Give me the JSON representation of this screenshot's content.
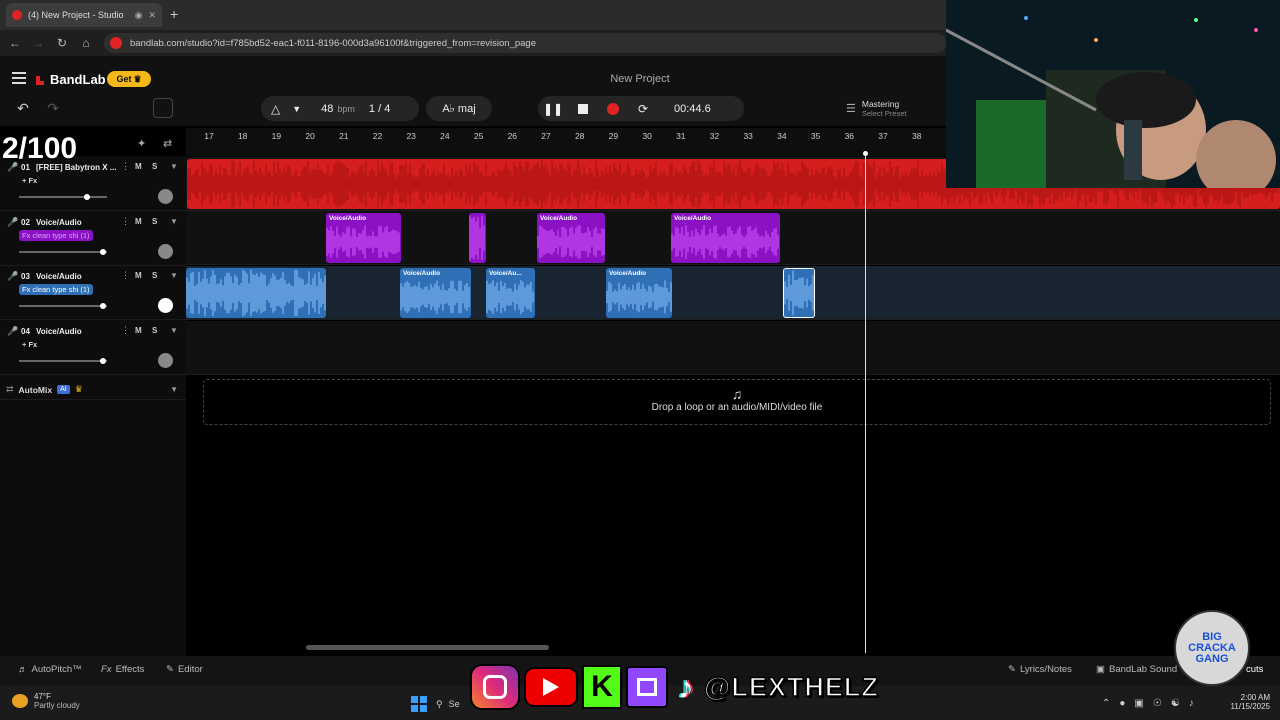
{
  "browser": {
    "tab_title": "(4) New Project - Studio",
    "url": "bandlab.com/studio?id=f785bd52-eac1-f011-8196-000d3a96100f&triggered_from=revision_page",
    "new_tab_symbol": "+"
  },
  "app": {
    "brand": "BandLab",
    "get_label": "Get",
    "project_title": "New Project"
  },
  "transport": {
    "bpm_value": "48",
    "bpm_unit": "bpm",
    "time_signature": "1 / 4",
    "key": "A♭ maj",
    "time": "00:44.6"
  },
  "mastering": {
    "title": "Mastering",
    "subtitle": "Select Preset"
  },
  "ruler": {
    "bars": [
      "17",
      "18",
      "19",
      "20",
      "21",
      "22",
      "23",
      "24",
      "25",
      "26",
      "27",
      "28",
      "29",
      "30",
      "31",
      "32",
      "33",
      "34",
      "35",
      "36",
      "37",
      "38"
    ]
  },
  "tracks": [
    {
      "number": "01",
      "name": "[FREE] Babytron X ...",
      "fx": "+ Fx",
      "color": "#e02424"
    },
    {
      "number": "02",
      "name": "Voice/Audio",
      "fx": "Fx clean type shi (1)",
      "color": "#9b1fd1"
    },
    {
      "number": "03",
      "name": "Voice/Audio",
      "fx": "Fx clean type shi (1)",
      "color": "#3e8fd8"
    },
    {
      "number": "04",
      "name": "Voice/Audio",
      "fx": "+ Fx",
      "color": "#2fbf71"
    }
  ],
  "clips": {
    "track2": [
      "Voice/Audio",
      "Voice/Audio",
      "Voice/Audio"
    ],
    "track3": [
      "Voice/Audio",
      "Voice/Au...",
      "Voice/Audio"
    ]
  },
  "mute_label": "M",
  "solo_label": "S",
  "automix": {
    "label": "AutoMix",
    "ai_badge": "AI"
  },
  "dropzone": {
    "text": "Drop a loop or an audio/MIDI/video file"
  },
  "bottom": {
    "autopitch": "AutoPitch™",
    "effects": "Effects",
    "editor": "Editor",
    "lyrics": "Lyrics/Notes",
    "sounds": "BandLab Sound",
    "shortcuts_partial": "cuts"
  },
  "taskbar": {
    "temp": "47°F",
    "weather": "Partly cloudy",
    "time": "2:00 AM",
    "date": "11/15/2025",
    "search_partial": "Se"
  },
  "overlay": {
    "counter": "2/100",
    "handle": "@LEXTHELZ",
    "badge_line1": "BIG",
    "badge_line2": "CRACKA",
    "badge_line3": "GANG"
  },
  "colors": {
    "track1": "#e02424",
    "track2": "#8a12c4",
    "track3": "#2f6fb5",
    "accent_get": "#f5b81a",
    "record": "#e02424"
  }
}
